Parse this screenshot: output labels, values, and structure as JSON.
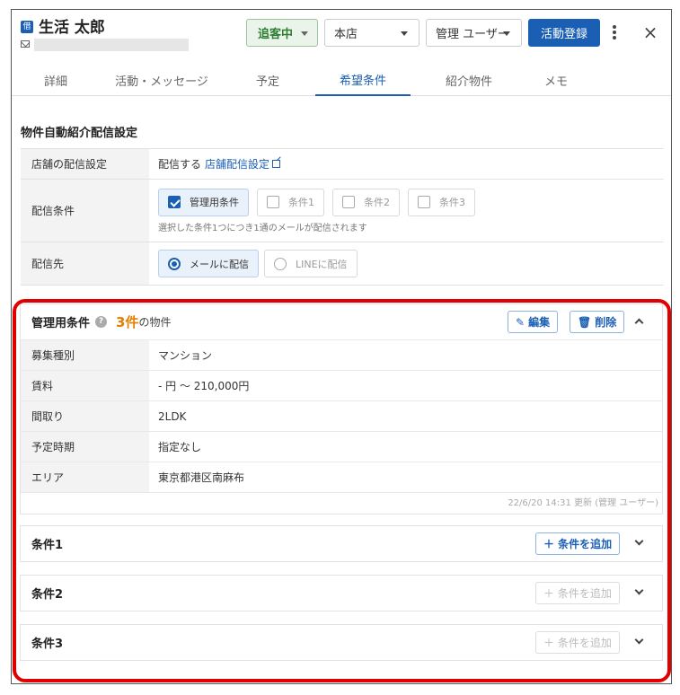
{
  "header": {
    "tag_icon_text": "借",
    "customer_name": "生活 太郎",
    "email_icon": "mail-icon",
    "status_label": "追客中",
    "store_select": "本店",
    "user_select": "管理 ユーザー",
    "register_button": "活動登録",
    "more_icon": "kebab-menu-icon",
    "close_icon": "×"
  },
  "tabs": [
    {
      "label": "詳細",
      "active": false
    },
    {
      "label": "活動・メッセージ",
      "active": false
    },
    {
      "label": "予定",
      "active": false
    },
    {
      "label": "希望条件",
      "active": true
    },
    {
      "label": "紹介物件",
      "active": false
    },
    {
      "label": "メモ",
      "active": false
    }
  ],
  "auto_delivery": {
    "section_title": "物件自動紹介配信設定",
    "store_setting_label": "店舗の配信設定",
    "store_setting_value": "配信する",
    "store_setting_link": "店舗配信設定",
    "conditions_label": "配信条件",
    "conditions": [
      {
        "label": "管理用条件",
        "checked": true
      },
      {
        "label": "条件1",
        "checked": false
      },
      {
        "label": "条件2",
        "checked": false
      },
      {
        "label": "条件3",
        "checked": false
      }
    ],
    "conditions_hint": "選択した条件1つにつき1通のメールが配信されます",
    "destination_label": "配信先",
    "destinations": [
      {
        "label": "メールに配信",
        "selected": true
      },
      {
        "label": "LINEに配信",
        "selected": false
      }
    ]
  },
  "admin_condition": {
    "title": "管理用条件",
    "count": "3件",
    "count_suffix": "の物件",
    "edit_button": "編集",
    "delete_button": "削除",
    "rows": [
      {
        "label": "募集種別",
        "value": "マンション"
      },
      {
        "label": "賃料",
        "value": "- 円 ～ 210,000円"
      },
      {
        "label": "間取り",
        "value": "2LDK"
      },
      {
        "label": "予定時期",
        "value": "指定なし"
      },
      {
        "label": "エリア",
        "value": "東京都港区南麻布"
      }
    ],
    "updated": "22/6/20 14:31 更新 (管理 ユーザー)"
  },
  "extra_conditions": [
    {
      "title": "条件1",
      "add_button": "＋ 条件を追加",
      "enabled": true
    },
    {
      "title": "条件2",
      "add_button": "＋ 条件を追加",
      "enabled": false
    },
    {
      "title": "条件3",
      "add_button": "＋ 条件を追加",
      "enabled": false
    }
  ],
  "colors": {
    "primary": "#1a5fb4",
    "status_green": "#2e7d32",
    "count_orange": "#e67e00",
    "highlight_red": "#e00000"
  }
}
